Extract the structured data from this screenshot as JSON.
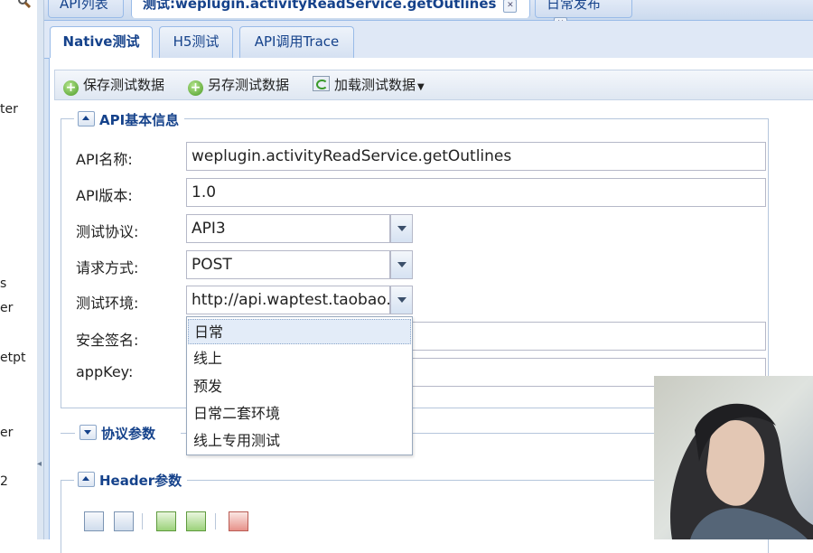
{
  "sidebar": {
    "fragments": [
      "ter",
      "s",
      "er",
      "etpt",
      "er",
      "2"
    ]
  },
  "top_tabs": [
    {
      "label": "API列表"
    },
    {
      "label": "测试:weplugin.activityReadService.getOutlines"
    },
    {
      "label": "日常发布"
    }
  ],
  "sub_tabs": [
    {
      "label": "Native测试"
    },
    {
      "label": "H5测试"
    },
    {
      "label": "API调用Trace"
    }
  ],
  "toolbar": {
    "save": "保存测试数据",
    "save_as": "另存测试数据",
    "load": "加载测试数据"
  },
  "basic_info": {
    "legend": "API基本信息",
    "api_name_label": "API名称:",
    "api_name": "weplugin.activityReadService.getOutlines",
    "api_version_label": "API版本:",
    "api_version": "1.0",
    "protocol_label": "测试协议:",
    "protocol": "API3",
    "method_label": "请求方式:",
    "method": "POST",
    "env_label": "测试环境:",
    "env": "http://api.waptest.taobao.",
    "sign_label": "安全签名:",
    "appkey_label": "appKey:"
  },
  "env_options": [
    "日常",
    "线上",
    "预发",
    "日常二套环境",
    "线上专用测试"
  ],
  "protocol_params": {
    "legend": "协议参数"
  },
  "header_params": {
    "legend": "Header参数"
  },
  "colors": {
    "accent": "#15428b",
    "panel_bg": "#d7e4f4",
    "border": "#99bbe8"
  }
}
